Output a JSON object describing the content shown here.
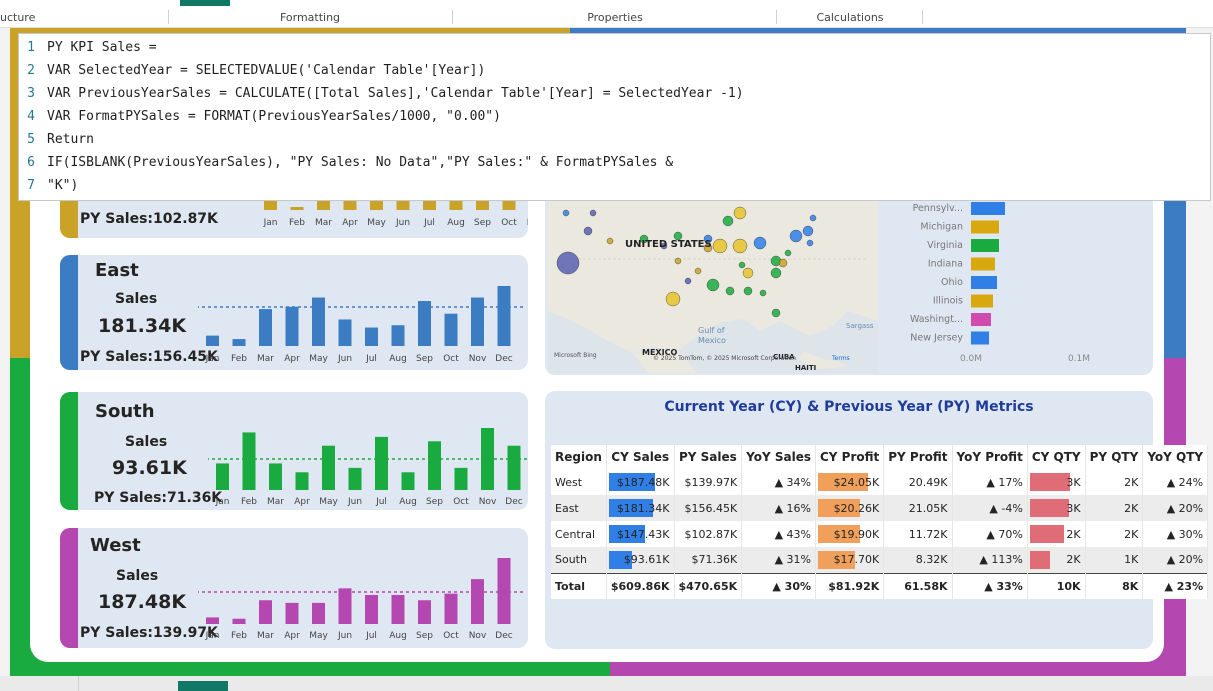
{
  "ribbon": {
    "tabs": [
      "ucture",
      "Formatting",
      "Properties",
      "Calculations"
    ]
  },
  "formula": {
    "lines": [
      {
        "num": "1",
        "text": "PY KPI Sales ="
      },
      {
        "num": "2",
        "text": "VAR SelectedYear = SELECTEDVALUE('Calendar Table'[Year])"
      },
      {
        "num": "3",
        "text": "VAR PreviousYearSales = CALCULATE([Total Sales],'Calendar Table'[Year] = SelectedYear -1)"
      },
      {
        "num": "4",
        "text": "VAR FormatPYSales = FORMAT(PreviousYearSales/1000, \"0.00\")"
      },
      {
        "num": "5",
        "text": "Return"
      },
      {
        "num": "6",
        "text": "IF(ISBLANK(PreviousYearSales), \"PY Sales: No Data\",\"PY Sales:\" & FormatPYSales &"
      },
      {
        "num": "7",
        "text": "\"K\")"
      }
    ]
  },
  "months": [
    "Jan",
    "Feb",
    "Mar",
    "Apr",
    "May",
    "Jun",
    "Jul",
    "Aug",
    "Sep",
    "Oct",
    "Nov",
    "Dec"
  ],
  "colors": {
    "central": "#c9a227",
    "east": "#3c7cc3",
    "south": "#1aab40",
    "west": "#b447b0",
    "bar_blue": "#2f7fe6",
    "bar_orange": "#f0a05a",
    "bar_red": "#e06c78"
  },
  "cards": {
    "central": {
      "py": "PY Sales:102.87K",
      "values": [
        4,
        1,
        4,
        4,
        4,
        4,
        4,
        4,
        4,
        4,
        4,
        4
      ]
    },
    "east": {
      "name": "East",
      "sales_label": "Sales",
      "sales": "181.34K",
      "py": "PY Sales:156.45K",
      "values": [
        9,
        6,
        32,
        34,
        42,
        23,
        16,
        18,
        39,
        28,
        42,
        52
      ]
    },
    "south": {
      "name": "South",
      "sales_label": "Sales",
      "sales": "93.61K",
      "py": "PY Sales:71.36K",
      "values": [
        6,
        13,
        6,
        4,
        10,
        5,
        12,
        4,
        11,
        5,
        14,
        10
      ]
    },
    "west": {
      "name": "West",
      "sales_label": "Sales",
      "sales": "187.48K",
      "py": "PY Sales:139.97K",
      "values": [
        5,
        4,
        18,
        16,
        16,
        27,
        22,
        22,
        18,
        23,
        34,
        50
      ]
    }
  },
  "map": {
    "country": "UNITED STATES",
    "gulf": "Gulf of Mexico",
    "mexico": "MEXICO",
    "sargasso": "Sargass",
    "cuba": "CUBA",
    "haiti": "HAITI",
    "copyright": "© 2025 TomTom, © 2025 Microsoft Corporation",
    "terms": "Terms",
    "bing": "Microsoft Bing"
  },
  "state_bars": {
    "states": [
      "Pennsylv...",
      "Michigan",
      "Virginia",
      "Indiana",
      "Ohio",
      "Illinois",
      "Washingt...",
      "New Jersey"
    ],
    "colors": [
      "#2f7fe6",
      "#d9a80f",
      "#1aab40",
      "#d9a80f",
      "#2f7fe6",
      "#d9a80f",
      "#d14aae",
      "#2f7fe6"
    ],
    "axis": [
      "0.0M",
      "0.1M"
    ]
  },
  "table": {
    "title": "Current Year (CY) & Previous Year (PY) Metrics",
    "headers": [
      "Region",
      "CY Sales",
      "PY Sales",
      "YoY Sales",
      "CY Profit",
      "PY Profit",
      "YoY Profit",
      "CY QTY",
      "PY QTY",
      "YoY QTY"
    ],
    "rows": [
      {
        "region": "West",
        "cy_sales": "$187.48K",
        "py_sales": "$139.97K",
        "yoy_sales": "▲ 34%",
        "cy_profit": "$24.05K",
        "py_profit": "20.49K",
        "yoy_profit": "▲ 17%",
        "cy_qty": "3K",
        "py_qty": "2K",
        "yoy_qty": "▲ 24%",
        "cy_sales_frac": 1.0,
        "cy_profit_frac": 1.0,
        "cy_qty_frac": 1.0
      },
      {
        "region": "East",
        "cy_sales": "$181.34K",
        "py_sales": "$156.45K",
        "yoy_sales": "▲ 16%",
        "cy_profit": "$20.26K",
        "py_profit": "21.05K",
        "yoy_profit": "▲ -4%",
        "cy_qty": "3K",
        "py_qty": "2K",
        "yoy_qty": "▲ 20%",
        "cy_sales_frac": 0.97,
        "cy_profit_frac": 0.84,
        "cy_qty_frac": 0.97
      },
      {
        "region": "Central",
        "cy_sales": "$147.43K",
        "py_sales": "$102.87K",
        "yoy_sales": "▲ 43%",
        "cy_profit": "$19.90K",
        "py_profit": "11.72K",
        "yoy_profit": "▲ 70%",
        "cy_qty": "2K",
        "py_qty": "2K",
        "yoy_qty": "▲ 30%",
        "cy_sales_frac": 0.79,
        "cy_profit_frac": 0.83,
        "cy_qty_frac": 0.85
      },
      {
        "region": "South",
        "cy_sales": "$93.61K",
        "py_sales": "$71.36K",
        "yoy_sales": "▲ 31%",
        "cy_profit": "$17.70K",
        "py_profit": "8.32K",
        "yoy_profit": "▲ 113%",
        "cy_qty": "2K",
        "py_qty": "1K",
        "yoy_qty": "▲ 20%",
        "cy_sales_frac": 0.5,
        "cy_profit_frac": 0.74,
        "cy_qty_frac": 0.5
      }
    ],
    "total": {
      "region": "Total",
      "cy_sales": "$609.86K",
      "py_sales": "$470.65K",
      "yoy_sales": "▲ 30%",
      "cy_profit": "$81.92K",
      "py_profit": "61.58K",
      "yoy_profit": "▲ 33%",
      "cy_qty": "10K",
      "py_qty": "8K",
      "yoy_qty": "▲ 23%"
    }
  }
}
